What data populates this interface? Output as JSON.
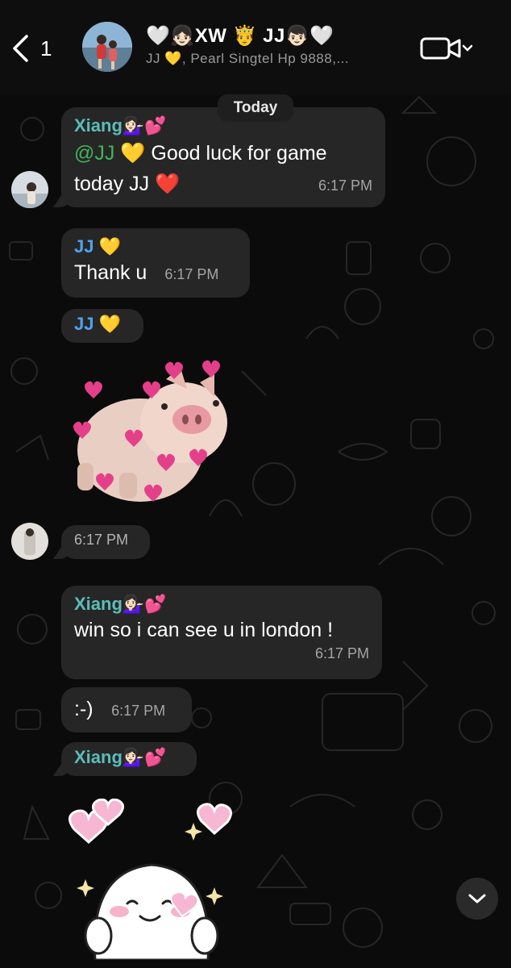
{
  "header": {
    "back_count": "1",
    "title": "🤍👧🏻XW 🤴 JJ👦🏻🤍",
    "subtitle": "JJ 💛, Pearl Singtel Hp 9888,..."
  },
  "date_label": "Today",
  "messages": [
    {
      "sender": "Xiang💁🏻‍♀️💕",
      "mention": "@JJ",
      "text_a": " 💛 Good luck for game",
      "text_b": "today JJ ❤️",
      "time": "6:17 PM"
    },
    {
      "sender": "JJ 💛",
      "text": "Thank u",
      "time": "6:17 PM"
    },
    {
      "sender": "JJ 💛"
    },
    {
      "time": "6:17 PM"
    },
    {
      "sender": "Xiang💁🏻‍♀️💕",
      "text": "win so i can see u in london !",
      "time": "6:17 PM"
    },
    {
      "text": ":-)",
      "time": "6:17 PM"
    },
    {
      "sender": "Xiang💁🏻‍♀️💕"
    }
  ],
  "icons": {
    "back": "chevron-left-icon",
    "video": "video-camera-icon",
    "scroll": "chevron-down-icon"
  },
  "colors": {
    "bubble": "#262626",
    "xiang_name": "#5bbdb9",
    "jj_name": "#52a3ee",
    "mention": "#42b45a"
  }
}
